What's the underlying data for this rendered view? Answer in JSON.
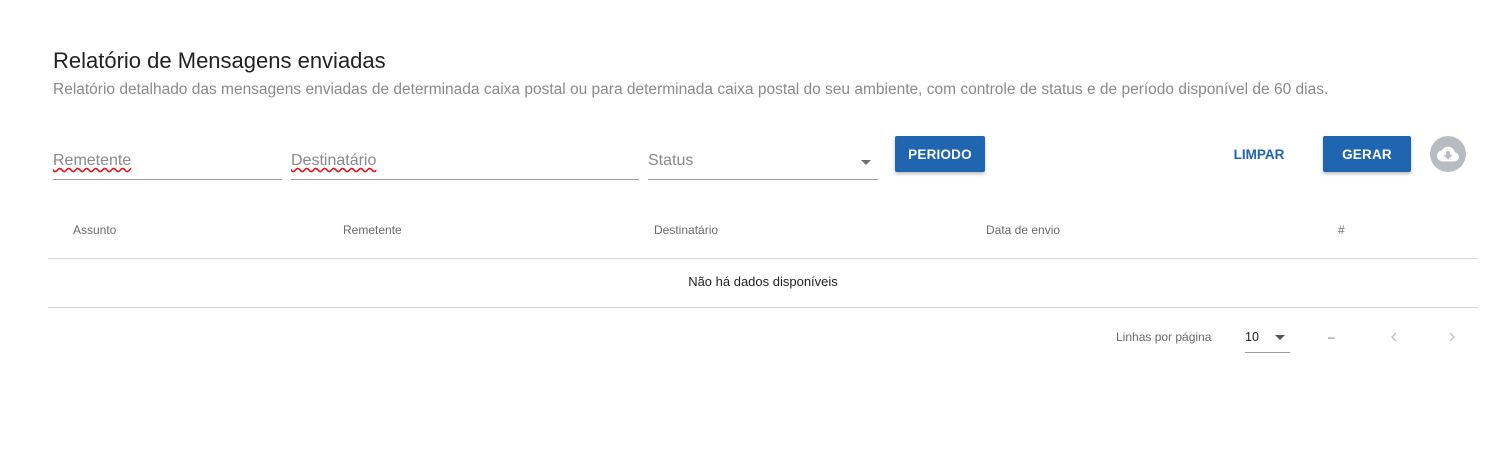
{
  "header": {
    "title": "Relatório de Mensagens enviadas",
    "subtitle": "Relatório detalhado das mensagens enviadas de determinada caixa postal ou para determinada caixa postal do seu ambiente, com controle de status e de período disponível de 60 dias."
  },
  "filters": {
    "sender_placeholder": "Remetente",
    "recipient_placeholder": "Destinatário",
    "status_placeholder": "Status",
    "period_button": "PERIODO",
    "clear_button": "LIMPAR",
    "generate_button": "GERAR",
    "download_icon": "cloud-download-icon"
  },
  "table": {
    "columns": [
      "Assunto",
      "Remetente",
      "Destinatário",
      "Data de envio",
      "#"
    ],
    "empty_message": "Não há dados disponíveis"
  },
  "pagination": {
    "rows_per_page_label": "Linhas por página",
    "rows_per_page_value": "10",
    "range_text": "–",
    "prev_icon": "chevron-left-icon",
    "next_icon": "chevron-right-icon"
  },
  "colors": {
    "accent": "#2065b0",
    "disabled_fab": "#b7bcc2",
    "spellcheck_underline": "#e0141a"
  }
}
